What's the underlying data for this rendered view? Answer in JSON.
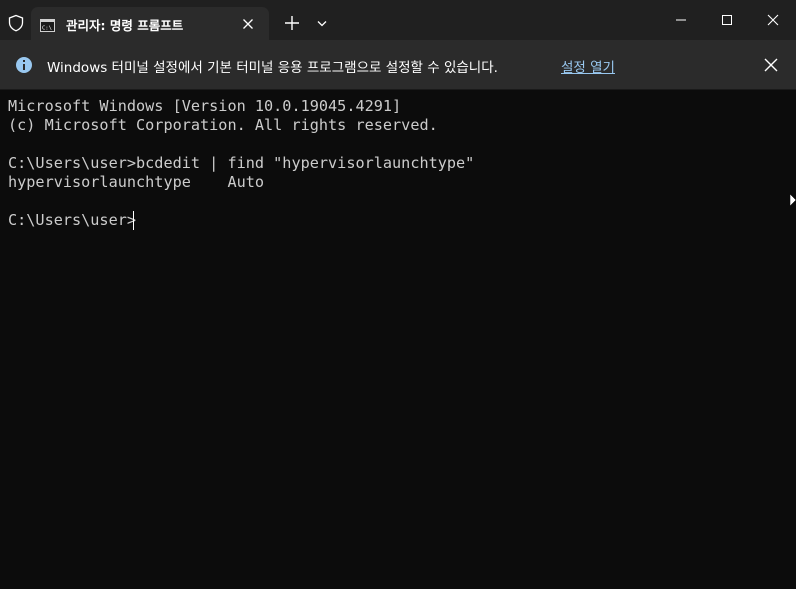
{
  "titlebar": {
    "tab_title": "관리자: 명령 프롬프트"
  },
  "infobar": {
    "message": "Windows 터미널 설정에서 기본 터미널 응용 프로그램으로 설정할 수 있습니다.",
    "link_label": "설정 열기"
  },
  "terminal": {
    "lines": [
      "Microsoft Windows [Version 10.0.19045.4291]",
      "(c) Microsoft Corporation. All rights reserved.",
      "C:\\Users\\user>bcdedit | find \"hypervisorlaunchtype\"",
      "hypervisorlaunchtype    Auto",
      "C:\\Users\\user>"
    ]
  },
  "icons": {
    "shield": "shield-icon",
    "tab": "cmd-icon",
    "tab_close": "close-icon",
    "new_tab": "plus-icon",
    "dropdown": "chevron-down-icon",
    "minimize": "minimize-icon",
    "maximize": "maximize-icon",
    "close": "close-icon",
    "info": "info-icon"
  },
  "colors": {
    "background": "#0c0c0c",
    "titlebar": "#202020",
    "infobar": "#2b2b2b",
    "text": "#cccccc",
    "link": "#99c8f0"
  }
}
